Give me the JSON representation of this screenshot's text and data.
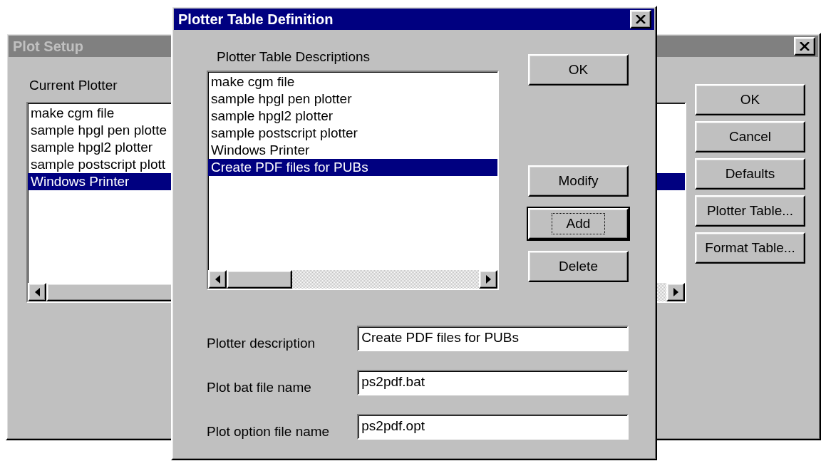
{
  "background_window": {
    "title": "Plot Setup",
    "active": false,
    "list_label": "Current Plotter",
    "plotters": [
      {
        "label": "make cgm file",
        "selected": false
      },
      {
        "label": "sample hpgl pen plotte",
        "selected": false
      },
      {
        "label": "sample hpgl2 plotter",
        "selected": false
      },
      {
        "label": "sample postscript plott",
        "selected": false
      },
      {
        "label": "Windows Printer",
        "selected": true
      }
    ],
    "buttons": [
      {
        "label": "OK",
        "default": false
      },
      {
        "label": "Cancel",
        "default": false
      },
      {
        "label": "Defaults",
        "default": false
      },
      {
        "label": "Plotter Table...",
        "default": false
      },
      {
        "label": "Format Table...",
        "default": false
      }
    ]
  },
  "dialog": {
    "title": "Plotter Table Definition",
    "active": true,
    "list_label": "Plotter Table Descriptions",
    "descriptions": [
      {
        "label": "make cgm file",
        "selected": false
      },
      {
        "label": "sample hpgl pen plotter",
        "selected": false
      },
      {
        "label": "sample hpgl2 plotter",
        "selected": false
      },
      {
        "label": "sample postscript plotter",
        "selected": false
      },
      {
        "label": "Windows Printer",
        "selected": false
      },
      {
        "label": "Create PDF files for PUBs",
        "selected": true
      }
    ],
    "buttons": [
      {
        "label": "OK",
        "default": false
      },
      {
        "label": "Modify",
        "default": false
      },
      {
        "label": "Add",
        "default": true
      },
      {
        "label": "Delete",
        "default": false
      }
    ],
    "fields": [
      {
        "label": "Plotter description",
        "value": "Create PDF files for PUBs"
      },
      {
        "label": "Plot bat file name",
        "value": "ps2pdf.bat"
      },
      {
        "label": "Plot option file name",
        "value": "ps2pdf.opt"
      }
    ]
  }
}
